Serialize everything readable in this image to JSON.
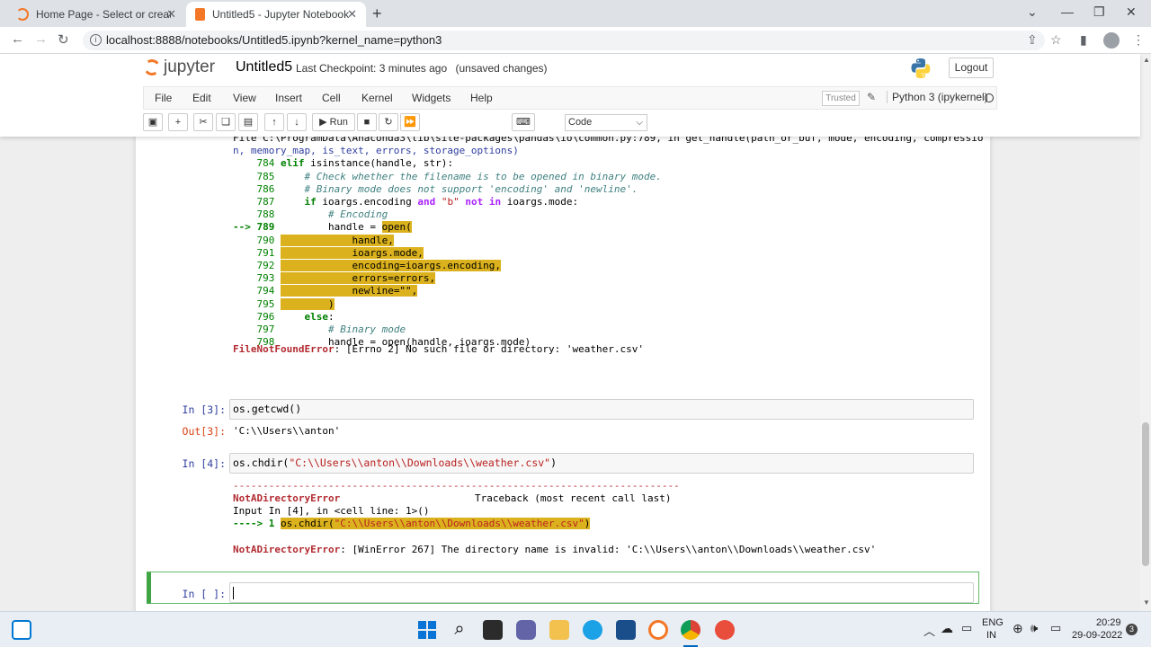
{
  "browser": {
    "tabs": [
      {
        "title": "Home Page - Select or create a n"
      },
      {
        "title": "Untitled5 - Jupyter Notebook"
      }
    ],
    "url": "localhost:8888/notebooks/Untitled5.ipynb?kernel_name=python3"
  },
  "jupyter": {
    "logo_text": "jupyter",
    "notebook_name": "Untitled5",
    "checkpoint_label": "Last Checkpoint:",
    "checkpoint_time": "3 minutes ago",
    "unsaved": "(unsaved changes)",
    "logout": "Logout",
    "menus": [
      "File",
      "Edit",
      "View",
      "Insert",
      "Cell",
      "Kernel",
      "Widgets",
      "Help"
    ],
    "trusted": "Trusted",
    "kernel": "Python 3 (ipykernel)",
    "run_label": "Run",
    "cell_type": "Code"
  },
  "cells": {
    "traceback_header": "File C:\\ProgramData\\Anaconda3\\lib\\site-packages\\pandas\\io\\common.py:789, in get_handle(path_or_buf, mode, encoding, compressio",
    "traceback_header2": "n, memory_map, is_text, errors, storage_options)",
    "error1": "FileNotFoundError",
    "error1_msg": ": [Errno 2] No such file or directory: 'weather.csv'",
    "in3_prompt": "In [3]:",
    "in3_code": "os.getcwd()",
    "out3_prompt": "Out[3]:",
    "out3_value": "'C:\\\\Users\\\\anton'",
    "in4_prompt": "In [4]:",
    "in4_code_fn": "os.chdir(",
    "in4_code_str": "\"C:\\\\Users\\\\anton\\\\Downloads\\\\weather.csv\"",
    "in4_code_end": ")",
    "dashes": "---------------------------------------------------------------------------",
    "error2": "NotADirectoryError",
    "traceback_label": "Traceback (most recent call last)",
    "input_line": "Input In [4], in <cell line: 1>()",
    "arrow_line": "----> 1 os.chdir(\"C:\\\\Users\\\\anton\\\\Downloads\\\\weather.csv\")",
    "error2_msg": ": [WinError 267] The directory name is invalid: 'C:\\\\Users\\\\anton\\\\Downloads\\\\weather.csv'",
    "empty_prompt": "In [ ]:"
  },
  "taskbar": {
    "lang": "ENG",
    "region": "IN",
    "time": "20:29",
    "date": "29-09-2022",
    "notifications": "3"
  }
}
